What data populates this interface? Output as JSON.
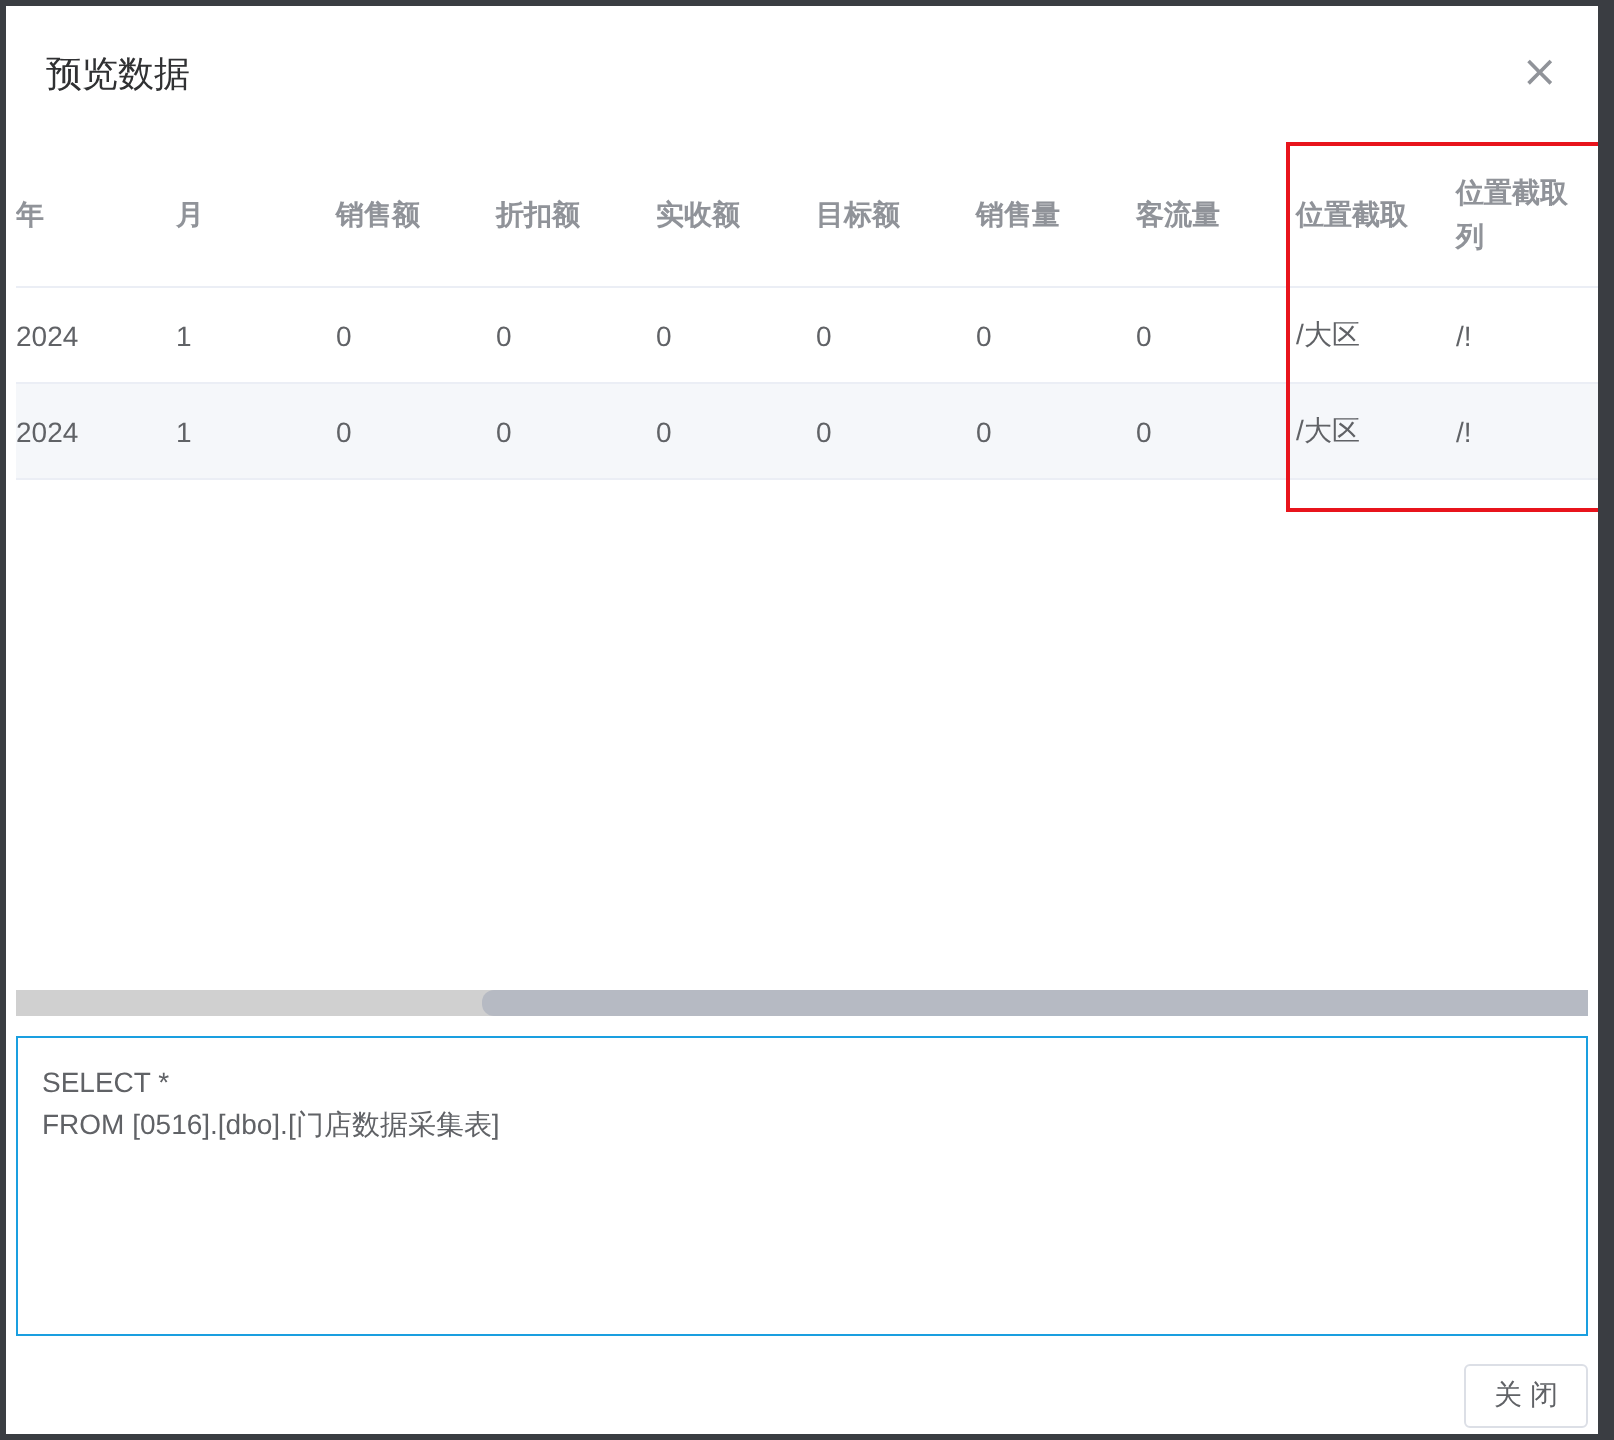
{
  "dialog": {
    "title": "预览数据",
    "close_icon": "×"
  },
  "table": {
    "columns": [
      {
        "label": "年",
        "highlighted": false
      },
      {
        "label": "月",
        "highlighted": false
      },
      {
        "label": "销售额",
        "highlighted": false
      },
      {
        "label": "折扣额",
        "highlighted": false
      },
      {
        "label": "实收额",
        "highlighted": false
      },
      {
        "label": "目标额",
        "highlighted": false
      },
      {
        "label": "销售量",
        "highlighted": false
      },
      {
        "label": "客流量",
        "highlighted": false
      },
      {
        "label": "位置截取",
        "highlighted": true
      },
      {
        "label": "位置截取列",
        "highlighted": true
      }
    ],
    "rows": [
      {
        "cells": [
          "2024",
          "1",
          "0",
          "0",
          "0",
          "0",
          "0",
          "0",
          "/大区",
          "/!"
        ]
      },
      {
        "cells": [
          "2024",
          "1",
          "0",
          "0",
          "0",
          "0",
          "0",
          "0",
          "/大区",
          "/!"
        ]
      }
    ]
  },
  "highlight": {
    "color": "#e8141c"
  },
  "sql": {
    "value": "SELECT *\nFROM [0516].[dbo].[门店数据采集表]"
  },
  "buttons": [
    "关 闭"
  ]
}
